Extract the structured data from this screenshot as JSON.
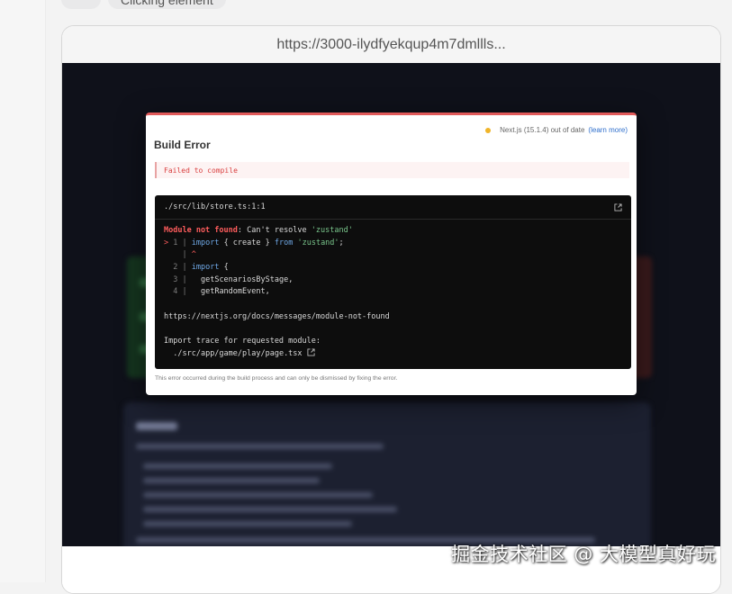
{
  "top": {
    "status_chip": "Clicking element"
  },
  "browser": {
    "url": "https://3000-ilydfyekqup4m7dmllls..."
  },
  "error_overlay": {
    "version_text": "Next.js (15.1.4) out of date",
    "learn_more": "(learn more)",
    "title": "Build Error",
    "failed_message": "Failed to compile",
    "file_path": "./src/lib/store.ts:1:1",
    "code": {
      "err_label": "Module not found",
      "err_rest": ": Can't resolve ",
      "err_module": "'zustand'",
      "line1_marker": ">",
      "line1_num": "1",
      "line1_import": "import",
      "line1_braces": " { create } ",
      "line1_from": "from",
      "line1_module": " 'zustand'",
      "line1_semi": ";",
      "caret": "^",
      "line2_num": "2",
      "line2_import": "import",
      "line2_rest": " {",
      "line3_num": "3",
      "line3_text": "getScenariosByStage,",
      "line4_num": "4",
      "line4_text": "getRandomEvent,",
      "docs_link": "https://nextjs.org/docs/messages/module-not-found",
      "trace_label": "Import trace for requested module:",
      "trace_path": "./src/app/game/play/page.tsx"
    },
    "footer_note": "This error occurred during the build process and can only be dismissed by fixing the error."
  },
  "watermark": "掘金技术社区 @ 大模型真好玩",
  "colors": {
    "error_accent": "#e15a5a",
    "code_bg": "#0d0d0d",
    "viewport_bg": "#0f111a"
  }
}
